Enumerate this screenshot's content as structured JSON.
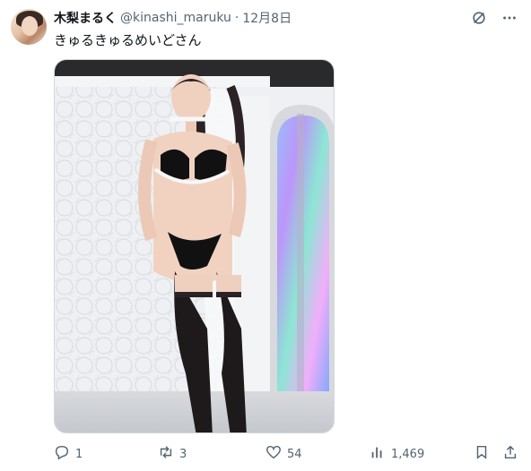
{
  "tweet": {
    "display_name": "木梨まるく",
    "handle": "@kinashi_maruku",
    "separator": "·",
    "date": "12月8日",
    "text": "きゅるきゅるめいどさん"
  },
  "actions": {
    "replies": "1",
    "reposts": "3",
    "likes": "54",
    "views": "1,469"
  },
  "icons": {
    "top": [
      "grok-icon",
      "more-icon"
    ],
    "bottom": [
      "reply-icon",
      "repost-icon",
      "like-icon",
      "views-icon",
      "bookmark-icon",
      "share-icon"
    ]
  },
  "colors": {
    "text": "#0f1419",
    "muted": "#536471"
  }
}
